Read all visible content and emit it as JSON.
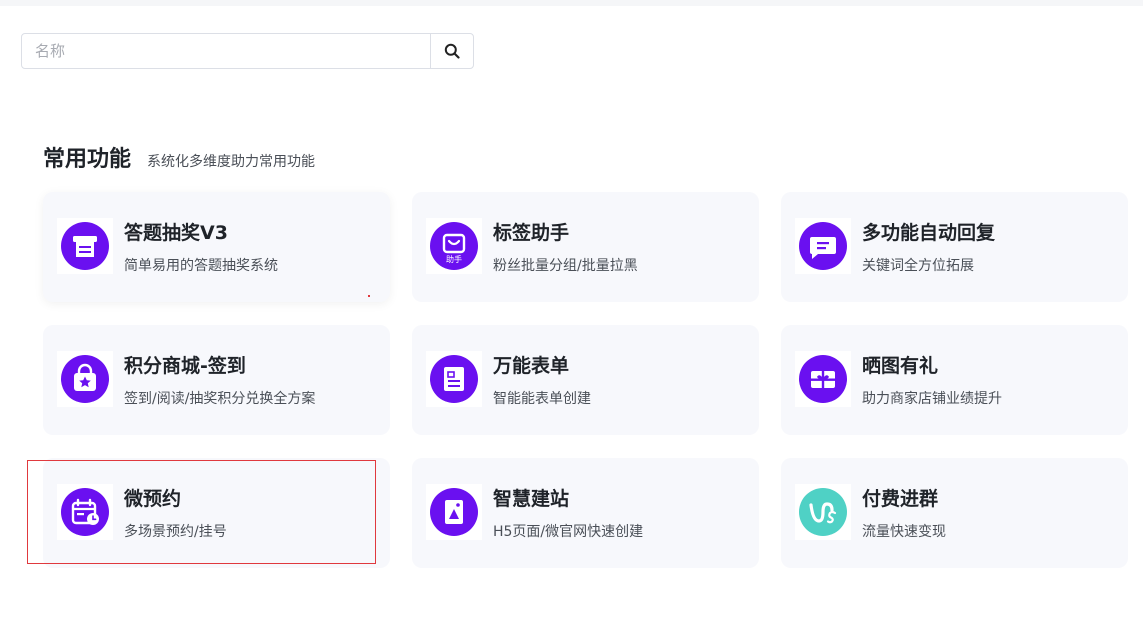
{
  "search": {
    "placeholder": "名称",
    "icon": "search-icon"
  },
  "section": {
    "title": "常用功能",
    "subtitle": "系统化多维度助力常用功能"
  },
  "cards": [
    {
      "title": "答题抽奖V3",
      "desc": "简单易用的答题抽奖系统",
      "icon": "quiz-lottery-icon"
    },
    {
      "title": "标签助手",
      "desc": "粉丝批量分组/批量拉黑",
      "icon": "tag-helper-icon",
      "badge": "助手"
    },
    {
      "title": "多功能自动回复",
      "desc": "关键词全方位拓展",
      "icon": "auto-reply-icon"
    },
    {
      "title": "积分商城-签到",
      "desc": "签到/阅读/抽奖积分兑换全方案",
      "icon": "points-mall-icon"
    },
    {
      "title": "万能表单",
      "desc": "智能能表单创建",
      "icon": "form-icon"
    },
    {
      "title": "晒图有礼",
      "desc": "助力商家店铺业绩提升",
      "icon": "gift-icon"
    },
    {
      "title": "微预约",
      "desc": "多场景预约/挂号",
      "icon": "calendar-clock-icon"
    },
    {
      "title": "智慧建站",
      "desc": "H5页面/微官网快速创建",
      "icon": "site-builder-icon"
    },
    {
      "title": "付费进群",
      "desc": "流量快速变现",
      "icon": "paid-group-icon"
    }
  ],
  "colors": {
    "accent": "#6a10f0",
    "teal": "#4fd1c5",
    "card_bg": "#f7f8fc",
    "highlight": "#e0393e"
  }
}
